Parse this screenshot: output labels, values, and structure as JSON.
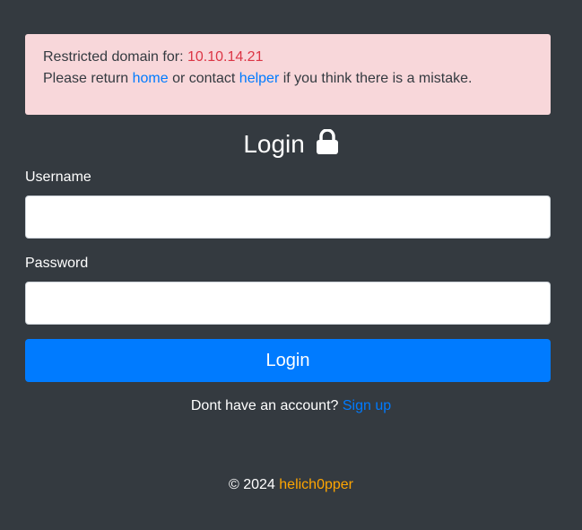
{
  "alert": {
    "line1_prefix": "Restricted domain for: ",
    "ip": "10.10.14.21",
    "line2_prefix": "Please return ",
    "home_link": "home",
    "line2_middle": " or contact ",
    "helper_link": "helper",
    "line2_suffix": " if you think there is a mistake."
  },
  "form": {
    "title": "Login",
    "title_icon": "lock-icon",
    "username_label": "Username",
    "username_value": "",
    "password_label": "Password",
    "password_value": "",
    "submit_label": "Login"
  },
  "signup": {
    "prompt": "Dont have an account? ",
    "link": "Sign up"
  },
  "footer": {
    "copyright": "© 2024 ",
    "author_link": "helich0pper"
  },
  "colors": {
    "background": "#343a40",
    "alert_bg": "#f8d7da",
    "ip_red": "#dc3545",
    "link_blue": "#007bff",
    "primary_button": "#007bff",
    "footer_link": "#ffa500"
  }
}
